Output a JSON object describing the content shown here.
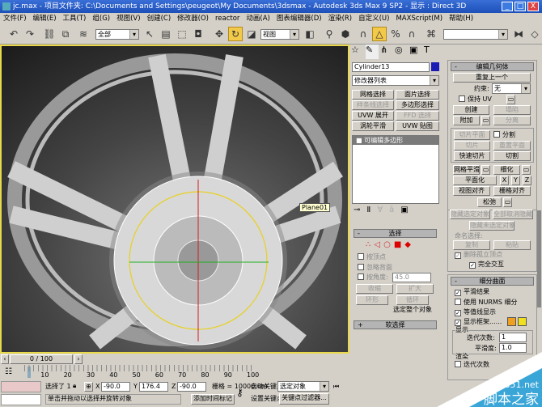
{
  "window": {
    "title": "jc.max   - 项目文件夹: C:\\Documents and Settings\\peugeot\\My Documents\\3dsmax   - Autodesk 3ds Max 9 SP2   - 显示 : Direct 3D",
    "controls": [
      "_",
      "□",
      "X"
    ]
  },
  "menu": [
    "文件(F)",
    "编辑(E)",
    "工具(T)",
    "组(G)",
    "视图(V)",
    "创建(C)",
    "修改器(O)",
    "reactor",
    "动画(A)",
    "图表编辑器(D)",
    "渲染(R)",
    "自定义(U)",
    "MAXScript(M)",
    "帮助(H)"
  ],
  "toolbar": {
    "selection_filter": "全部",
    "ref_coord": "视图",
    "named_sel": ""
  },
  "viewport": {
    "object_label": "Plane01",
    "scroll": "0 / 100"
  },
  "command_panel": {
    "object_name": "Cylinder13",
    "object_color": "#1a1ab4",
    "modifier_list": "修改器列表",
    "modifier_buttons": [
      "网格选择",
      "面片选择",
      "样条线选择",
      "多边形选择",
      "UVW 展开",
      "FFD 选择",
      "涡轮平滑",
      "UVW 贴图"
    ],
    "stack_item": "可编辑多边形",
    "selection": {
      "title": "选择",
      "by_vertex": "按顶点",
      "ignore_backfacing": "忽略背面",
      "by_angle": "按角度:",
      "angle": "45.0",
      "shrink": "收缩",
      "grow": "扩大",
      "ring": "环形",
      "loop": "循环",
      "status": "选定整个对象"
    },
    "soft_selection": {
      "title": "软选择"
    },
    "edit_geometry": {
      "title": "编辑几何体",
      "repeat_last": "重复上一个",
      "constraints_label": "约束:",
      "constraints": "无",
      "preserve_uvs": "保持 UV",
      "create": "创建",
      "collapse": "塌陷",
      "attach": "附加",
      "detach": "分离",
      "slice_plane": "切片平面",
      "split": "分割",
      "slice": "切片",
      "reset_plane": "重置平面",
      "quickslice": "快速切片",
      "cut": "切割",
      "meshsmooth": "网格平滑",
      "tessellate": "细化",
      "make_planar": "平面化",
      "x": "X",
      "y": "Y",
      "z": "Z",
      "view_align": "视图对齐",
      "grid_align": "栅格对齐",
      "relax": "松弛",
      "hide_selected": "隐藏选定对象",
      "unhide_all": "全部取消隐藏",
      "hide_unselected": "隐藏未选定对象",
      "named_selections": "命名选择:",
      "copy": "复制",
      "paste": "粘贴",
      "delete_isolated": "删除孤立顶点",
      "full_interactivity": "完全交互"
    },
    "subdivision": {
      "title": "细分曲面",
      "smooth_result": "平滑结果",
      "use_nurms": "使用 NURMS 细分",
      "isoline": "等值线显示",
      "show_cage": "显示框架......",
      "cage_colors": [
        "#f0a020",
        "#f0e020"
      ],
      "display": "显示",
      "iterations_label": "迭代次数:",
      "iterations": "1",
      "smoothness_label": "平滑度:",
      "smoothness": "1.0",
      "render": "渲染",
      "render_iterations": "迭代次数"
    }
  },
  "timeline": {
    "ticks": [
      "0",
      "10",
      "20",
      "30",
      "40",
      "50",
      "60",
      "70",
      "80",
      "90",
      "100"
    ]
  },
  "status": {
    "selected": "选择了 1",
    "x_label": "X",
    "x": "-90.0",
    "y_label": "Y",
    "y": "176.4",
    "z_label": "Z",
    "z": "-90.0",
    "grid": "栅格 = 10000.0m",
    "prompt": "单击并拖动以选择并旋转对象",
    "add_time_tag": "添加时间标记",
    "auto_key": "自动关键点",
    "key_mode": "选定对象",
    "set_key": "设置关键点",
    "key_filters": "关键点过滤器..."
  },
  "watermark": {
    "url": "jb51.net",
    "name": "脚本之家"
  }
}
